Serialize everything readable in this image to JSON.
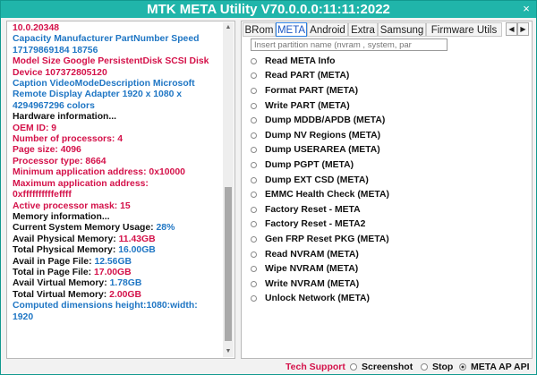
{
  "window": {
    "title": "MTK META Utility V70.0.0.0:11:11:2022",
    "close_glyph": "×"
  },
  "log": {
    "lines": [
      {
        "text": "10.0.20348",
        "color": "red"
      },
      {
        "text": "Capacity Manufacturer PartNumber Speed",
        "color": "blue"
      },
      {
        "text": "17179869184 18756",
        "color": "blue"
      },
      {
        "text": "Model Size Google PersistentDisk SCSI Disk",
        "color": "red"
      },
      {
        "text": "Device 107372805120",
        "color": "red"
      },
      {
        "text": "Caption VideoModeDescription Microsoft",
        "color": "blue"
      },
      {
        "text": "Remote Display Adapter 1920 x 1080 x",
        "color": "blue"
      },
      {
        "text": "4294967296 colors",
        "color": "blue"
      },
      {
        "text": "Hardware information...",
        "color": "black"
      },
      {
        "text": "OEM ID: 9",
        "color": "red"
      },
      {
        "text": "Number of processors: 4",
        "color": "red"
      },
      {
        "text": "Page size: 4096",
        "color": "red"
      },
      {
        "text": "Processor type: 8664",
        "color": "red"
      },
      {
        "text": "Minimum application address: 0x10000",
        "color": "red"
      },
      {
        "text": "Maximum application address:",
        "color": "red"
      },
      {
        "text": "0xffffffffffeffff",
        "color": "red"
      },
      {
        "text": "Active processor mask: 15",
        "color": "red"
      },
      {
        "text": "Memory information...",
        "color": "black"
      }
    ],
    "memory": [
      {
        "label": "Current System Memory Usage: ",
        "value": "28%",
        "value_color": "blue"
      },
      {
        "label": "Avail Physical Memory: ",
        "value": "11.43GB",
        "value_color": "red"
      },
      {
        "label": "Total Physical Memory: ",
        "value": "16.00GB",
        "value_color": "blue"
      },
      {
        "label": "Avail in Page File: ",
        "value": "12.56GB",
        "value_color": "blue"
      },
      {
        "label": "Total in Page File: ",
        "value": "17.00GB",
        "value_color": "red"
      },
      {
        "label": "Avail Virtual Memory: ",
        "value": "1.78GB",
        "value_color": "blue"
      },
      {
        "label": "Total Virtual Memory: ",
        "value": "2.00GB",
        "value_color": "red"
      }
    ],
    "tail": [
      {
        "text": "Computed dimensions height:1080:width:",
        "color": "blue"
      },
      {
        "text": "1920",
        "color": "blue"
      }
    ]
  },
  "tabs": {
    "items": [
      "BRom",
      "META",
      "Android",
      "Extra",
      "Samsung",
      "Firmware Utils"
    ],
    "active": "META",
    "prev_glyph": "◀",
    "next_glyph": "▶"
  },
  "search": {
    "placeholder": "Insert partition name (nvram , system, par"
  },
  "options": [
    "Read META Info",
    "Read PART (META)",
    "Format PART (META)",
    "Write PART (META)",
    "Dump MDDB/APDB (META)",
    "Dump NV Regions (META)",
    "Dump USERAREA (META)",
    "Dump PGPT (META)",
    "Dump  EXT CSD (META)",
    "EMMC Health Check (META)",
    "Factory Reset - META",
    "Factory Reset - META2",
    "Gen FRP Reset PKG (META)",
    "Read NVRAM (META)",
    "Wipe NVRAM (META)",
    "Write NVRAM (META)",
    "Unlock Network (META)"
  ],
  "bottom": {
    "tech_support": "Tech Support",
    "screenshot": "Screenshot",
    "stop": "Stop",
    "api": "META AP API"
  },
  "colors": {
    "title_bar": "#20b5aa",
    "accent_red": "#d4124a",
    "accent_blue": "#1f76c4"
  }
}
